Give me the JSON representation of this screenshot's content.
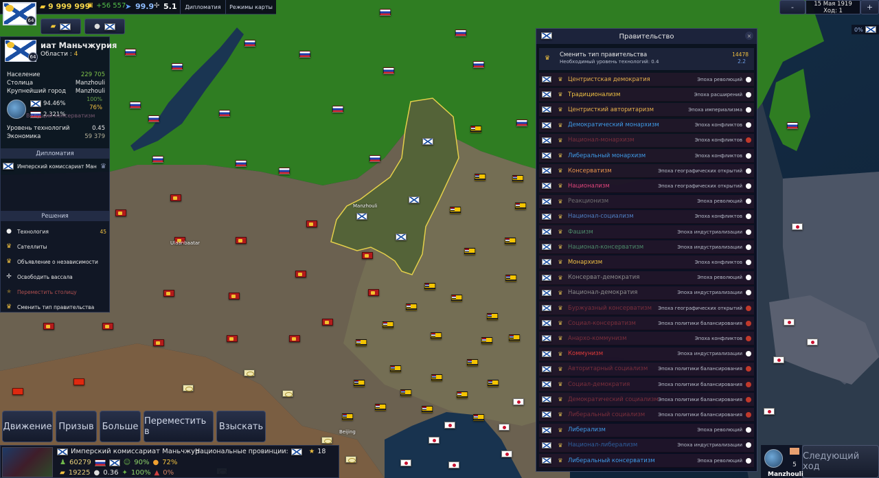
{
  "topbar": {
    "gold": "9 999 999",
    "gold_delta": "+56 557",
    "speed": "99.9",
    "version": "5.1",
    "tab_diplomacy": "Дипломатия",
    "tab_map_modes": "Режимы карты",
    "country_level": "64"
  },
  "date": {
    "line1": "15 Мая 1919",
    "line2": "Ход: 1",
    "minus": "-",
    "plus": "+"
  },
  "right_badge": "0%",
  "country": {
    "name": "иат Маньчжурия",
    "regions_label": "Области :",
    "regions_value": "4",
    "level": "64",
    "stats": [
      {
        "label": "Население",
        "value": "229 705"
      },
      {
        "label": "Столица",
        "value": "Manzhouli"
      },
      {
        "label": "Крупнейший город",
        "value": "Manzhouli"
      }
    ],
    "pct_main": "94.46%",
    "pct_secondary": "2.321%",
    "pct_right1": "100%",
    "pct_right2": "76%",
    "ideology_faded": "Ведущий консерватизм",
    "tech_label": "Уровень технологий",
    "tech_value": "0.45",
    "economy_label": "Экономика",
    "economy_value": "59 379"
  },
  "diplomacy": {
    "title": "Дипломатия",
    "entry": "Имперский комиссариат Манч"
  },
  "decisions": {
    "title": "Решения",
    "items": [
      {
        "label": "Технология",
        "value": "45",
        "icon": "bulb-icon"
      },
      {
        "label": "Сателлиты",
        "value": "",
        "icon": "crown-icon"
      },
      {
        "label": "Объявление о независимости",
        "value": "",
        "icon": "crown-icon"
      },
      {
        "label": "Освободить вассала",
        "value": "",
        "icon": "dove-icon"
      },
      {
        "label": "Переместить столицу",
        "value": "",
        "icon": "star-icon"
      },
      {
        "label": "Сменить тип правительства",
        "value": "",
        "icon": "crown-icon"
      }
    ]
  },
  "government": {
    "title": "Правительство",
    "change_label": "Сменить тип правительства",
    "tech_req": "Необходимый уровень технологий: 0.4",
    "cost": "14478",
    "cost2": "2.2",
    "items": [
      {
        "name": "Центристская демократия",
        "era": "Эпоха революций",
        "color": "#e8b24c",
        "dot": "#ffffff"
      },
      {
        "name": "Традиционализм",
        "era": "Эпоха расширений",
        "color": "#f1c244",
        "dot": "#ffffff"
      },
      {
        "name": "Центристкий авторитаризм",
        "era": "Эпоха империализма",
        "color": "#e8b24c",
        "dot": "#ffffff"
      },
      {
        "name": "Демократический монархизм",
        "era": "Эпоха конфликтов",
        "color": "#3f9be8",
        "dot": "#ffffff"
      },
      {
        "name": "Национал-монархизм",
        "era": "Эпоха конфликтов",
        "color": "#7a2f3c",
        "dot": "#c0392b"
      },
      {
        "name": "Либеральный монархизм",
        "era": "Эпоха конфликтов",
        "color": "#3f9be8",
        "dot": "#ffffff"
      },
      {
        "name": "Консерватизм",
        "era": "Эпоха географических открытий",
        "color": "#e8944c",
        "dot": "#ffffff"
      },
      {
        "name": "Национализм",
        "era": "Эпоха географических открытий",
        "color": "#e0457b",
        "dot": "#ffffff"
      },
      {
        "name": "Реакционизм",
        "era": "Эпоха революций",
        "color": "#6f6f6f",
        "dot": "#ffffff"
      },
      {
        "name": "Национал-социализм",
        "era": "Эпоха конфликтов",
        "color": "#4f7fc4",
        "dot": "#ffffff"
      },
      {
        "name": "Фашизм",
        "era": "Эпоха индустриализации",
        "color": "#4d8b6a",
        "dot": "#ffffff"
      },
      {
        "name": "Национал-консерватизм",
        "era": "Эпоха индустриализации",
        "color": "#4d8b6a",
        "dot": "#ffffff"
      },
      {
        "name": "Монархизм",
        "era": "Эпоха конфликтов",
        "color": "#f1c244",
        "dot": "#ffffff"
      },
      {
        "name": "Консерват-демократия",
        "era": "Эпоха революций",
        "color": "#8c8c8c",
        "dot": "#ffffff"
      },
      {
        "name": "Национал-демократия",
        "era": "Эпоха индустриализации",
        "color": "#8c8c8c",
        "dot": "#ffffff"
      },
      {
        "name": "Буржуазный консерватизм",
        "era": "Эпоха географических открытий",
        "color": "#7a2f3c",
        "dot": "#c0392b"
      },
      {
        "name": "Социал-консерватизм",
        "era": "Эпоха политики балансирования",
        "color": "#7a2f3c",
        "dot": "#c0392b"
      },
      {
        "name": "Анархо-коммунизм",
        "era": "Эпоха конфликтов",
        "color": "#7a2f3c",
        "dot": "#c0392b"
      },
      {
        "name": "Коммунизм",
        "era": "Эпоха индустриализации",
        "color": "#e23b3b",
        "dot": "#ffffff"
      },
      {
        "name": "Авторитарный социализм",
        "era": "Эпоха политики балансирования",
        "color": "#7a2f3c",
        "dot": "#c0392b"
      },
      {
        "name": "Социал-демократия",
        "era": "Эпоха политики балансирования",
        "color": "#7a2f3c",
        "dot": "#c0392b"
      },
      {
        "name": "Демократический социализм",
        "era": "Эпоха политики балансирования",
        "color": "#7a2f3c",
        "dot": "#c0392b"
      },
      {
        "name": "Либеральный социализм",
        "era": "Эпоха политики балансирования",
        "color": "#7a2f3c",
        "dot": "#c0392b"
      },
      {
        "name": "Либерализм",
        "era": "Эпоха революций",
        "color": "#3f9be8",
        "dot": "#ffffff"
      },
      {
        "name": "Национал-либерализм",
        "era": "Эпоха индустриализации",
        "color": "#2f5f9e",
        "dot": "#ffffff"
      },
      {
        "name": "Либеральный консерватизм",
        "era": "Эпоха революций",
        "color": "#3f9be8",
        "dot": "#ffffff"
      }
    ]
  },
  "actions": {
    "move": "Движение",
    "draft": "Призыв",
    "more": "Больше",
    "relocate": "Переместить в",
    "collect": "Взыскать"
  },
  "bottom": {
    "country_name": "Имперский комиссариат Маньчжур",
    "national_provinces": "Национальные провинции:",
    "provinces_count": "18",
    "population": "60279",
    "money": "19225",
    "pct1": "90%",
    "pct2": "72%",
    "tech": "0.36",
    "pct3": "100%",
    "pct4": "0%"
  },
  "map_labels": {
    "manzhouli": "Manzhouli",
    "ulaanbaatar": "Ulaanbaatar",
    "beijing": "Beijing",
    "bottom_right_city": "Manzhouli"
  },
  "next_turn": {
    "label": "Следующий ход",
    "count": "5"
  }
}
